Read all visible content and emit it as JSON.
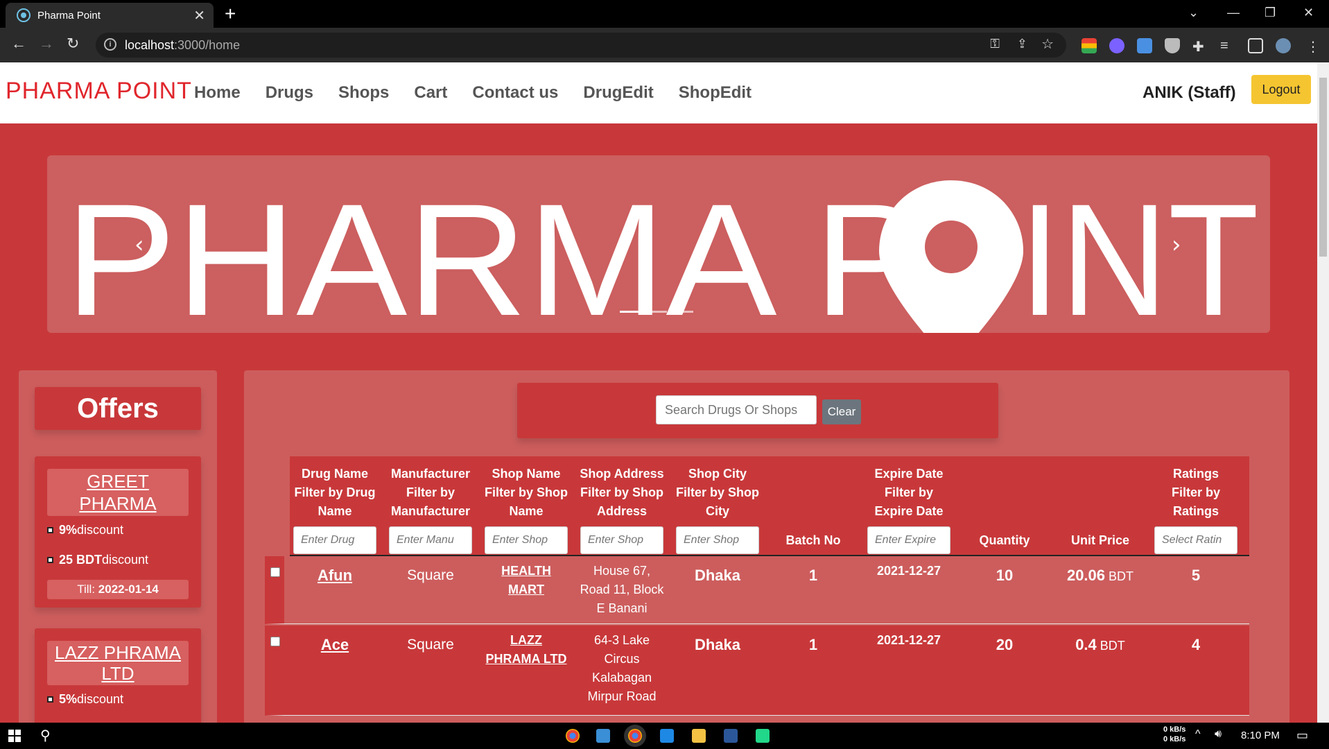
{
  "browser": {
    "tab_title": "Pharma Point",
    "url_host": "localhost",
    "url_path": ":3000/home"
  },
  "navbar": {
    "brand": "PHARMA POINT",
    "links": [
      "Home",
      "Drugs",
      "Shops",
      "Cart",
      "Contact us",
      "DrugEdit",
      "ShopEdit"
    ],
    "user": "ANIK (Staff)",
    "logout": "Logout"
  },
  "hero": {
    "text_left": "PHARMA P",
    "text_right": "INT"
  },
  "offers": {
    "title": "Offers",
    "items": [
      {
        "name": "GREET PHARMA",
        "discount_pct": "9%",
        "discount_pct_suffix": " discount",
        "discount_bdt": "25 BDT",
        "discount_bdt_suffix": " discount",
        "till_label": "Till: ",
        "till_date": "2022-01-14"
      },
      {
        "name": "LAZZ PHRAMA LTD",
        "discount_pct": "5%",
        "discount_pct_suffix": " discount"
      }
    ]
  },
  "search": {
    "placeholder": "Search Drugs Or Shops",
    "clear": "Clear"
  },
  "table": {
    "headers": {
      "drug": [
        "Drug Name",
        "Filter by Drug",
        "Name"
      ],
      "manufacturer": [
        "Manufacturer",
        "Filter by",
        "Manufacturer"
      ],
      "shop_name": [
        "Shop Name",
        "Filter by Shop",
        "Name"
      ],
      "shop_address": [
        "Shop Address",
        "Filter by Shop",
        "Address"
      ],
      "shop_city": [
        "Shop City",
        "Filter by Shop",
        "City"
      ],
      "batch": "Batch No",
      "expire": [
        "Expire Date",
        "Filter by",
        "Expire Date"
      ],
      "quantity": "Quantity",
      "unit_price": "Unit Price",
      "ratings": [
        "Ratings",
        "Filter by",
        "Ratings"
      ]
    },
    "placeholders": {
      "drug": "Enter Drug",
      "manufacturer": "Enter Manu",
      "shop_name": "Enter Shop",
      "shop_address": "Enter Shop",
      "shop_city": "Enter Shop",
      "expire": "Enter Expire",
      "ratings": "Select Ratin"
    },
    "rows": [
      {
        "drug": "Afun",
        "manufacturer": "Square",
        "shop_name": [
          "HEALTH",
          "MART"
        ],
        "shop_address": [
          "House 67,",
          "Road 11, Block",
          "E Banani"
        ],
        "city": "Dhaka",
        "batch": "1",
        "expire": "2021-12-27",
        "quantity": "10",
        "price": "20.06",
        "currency": " BDT",
        "rating": "5"
      },
      {
        "drug": "Ace",
        "manufacturer": "Square",
        "shop_name": [
          "LAZZ",
          "PHRAMA LTD"
        ],
        "shop_address": [
          "64-3 Lake",
          "Circus",
          "Kalabagan",
          "Mirpur Road"
        ],
        "city": "Dhaka",
        "batch": "1",
        "expire": "2021-12-27",
        "quantity": "20",
        "price": "0.4",
        "currency": " BDT",
        "rating": "4"
      }
    ]
  },
  "taskbar": {
    "net_up": "0 kB/s",
    "net_down": "0 kB/s",
    "time": "8:10 PM"
  }
}
